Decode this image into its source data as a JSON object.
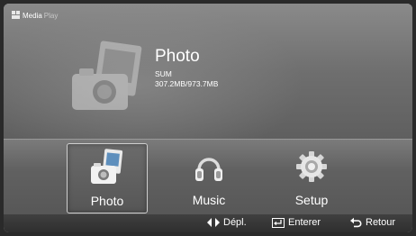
{
  "brand": {
    "primary": "Media",
    "secondary": "Play"
  },
  "current": {
    "title": "Photo",
    "device": "SUM",
    "storage": "307.2MB/973.7MB"
  },
  "menu": {
    "selected_index": 0,
    "items": [
      {
        "label": "Photo",
        "icon": "photo-icon"
      },
      {
        "label": "Music",
        "icon": "headphones-icon"
      },
      {
        "label": "Setup",
        "icon": "gear-icon"
      }
    ]
  },
  "footer": {
    "move": {
      "icon": "left-right-arrows-icon",
      "label": "Dépl."
    },
    "enter": {
      "icon": "enter-icon",
      "label": "Enterer"
    },
    "back": {
      "icon": "return-icon",
      "label": "Retour"
    }
  },
  "colors": {
    "text": "#ffffff",
    "selection_border": "#cfcfcf"
  }
}
